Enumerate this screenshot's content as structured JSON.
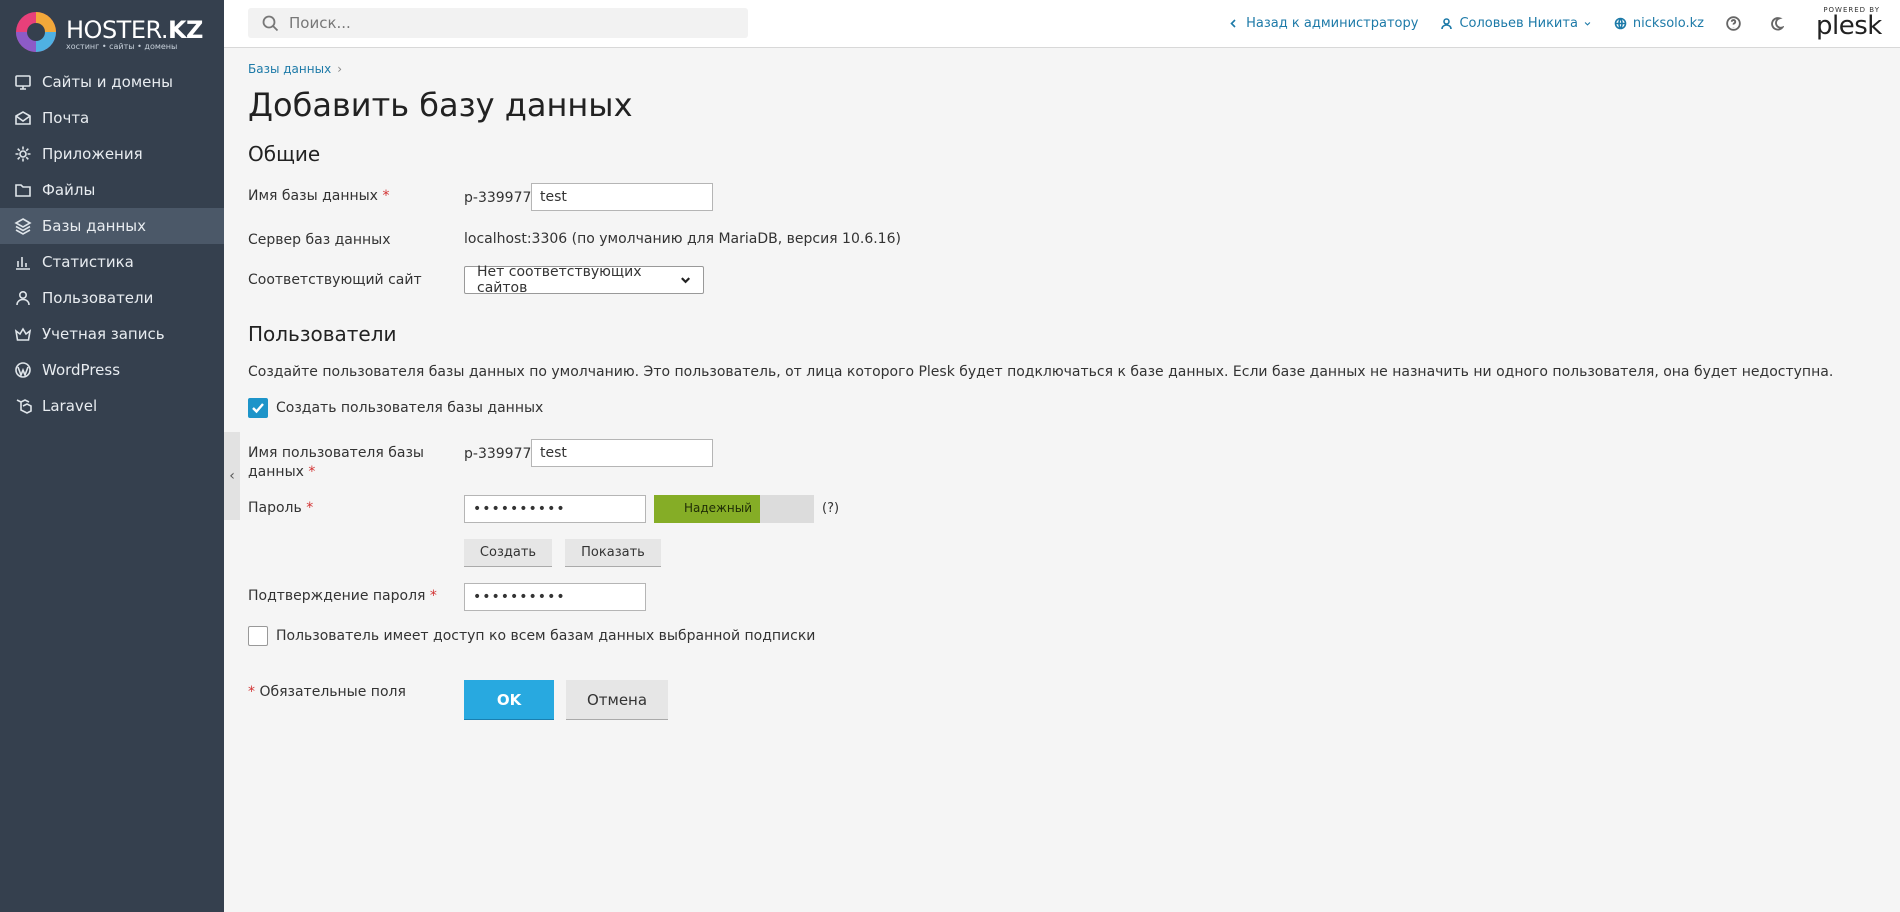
{
  "brand": {
    "logo_main": "HOSTER.",
    "logo_bold": "KZ",
    "logo_sub": "хостинг • сайты • домены",
    "plesk_powered": "POWERED BY",
    "plesk_name": "plesk"
  },
  "sidebar": {
    "items": [
      {
        "label": "Сайты и домены",
        "icon": "monitor-icon"
      },
      {
        "label": "Почта",
        "icon": "mail-icon"
      },
      {
        "label": "Приложения",
        "icon": "gear-icon"
      },
      {
        "label": "Файлы",
        "icon": "folder-icon"
      },
      {
        "label": "Базы данных",
        "icon": "layers-icon",
        "active": true
      },
      {
        "label": "Статистика",
        "icon": "bar-chart-icon"
      },
      {
        "label": "Пользователи",
        "icon": "user-icon"
      },
      {
        "label": "Учетная запись",
        "icon": "crown-icon"
      },
      {
        "label": "WordPress",
        "icon": "wordpress-icon"
      },
      {
        "label": "Laravel",
        "icon": "laravel-icon"
      }
    ]
  },
  "topbar": {
    "search_placeholder": "Поиск...",
    "back_link": "Назад к администратору",
    "user_name": "Соловьев Никита",
    "domain": "nicksolo.kz"
  },
  "breadcrumb": {
    "item": "Базы данных"
  },
  "page": {
    "title": "Добавить базу данных"
  },
  "general": {
    "title": "Общие",
    "db_name_label": "Имя базы данных",
    "db_name_prefix": "p-339977_",
    "db_name_value": "test",
    "db_server_label": "Сервер баз данных",
    "db_server_value": "localhost:3306 (по умолчанию для MariaDB, версия 10.6.16)",
    "site_label": "Соответствующий сайт",
    "site_value": "Нет соответствующих сайтов"
  },
  "users": {
    "title": "Пользователи",
    "description": "Создайте пользователя базы данных по умолчанию. Это пользователь, от лица которого Plesk будет подключаться к базе данных. Если базе данных не назначить ни одного пользователя, она будет недоступна.",
    "create_user_label": "Создать пользователя базы данных",
    "create_user_checked": true,
    "username_label_1": "Имя пользователя базы",
    "username_label_2": "данных",
    "username_prefix": "p-339977_",
    "username_value": "test",
    "password_label": "Пароль",
    "password_value": "••••••••••",
    "strength_label": "Надежный",
    "strength_fraction": 0.66,
    "help": "(?)",
    "generate_button": "Создать",
    "show_button": "Показать",
    "confirm_label": "Подтверждение пароля",
    "confirm_value": "••••••••••",
    "all_db_access_label": "Пользователь имеет доступ ко всем базам данных выбранной подписки",
    "all_db_access_checked": false
  },
  "footer": {
    "required_star": "*",
    "required_label": "Обязательные поля",
    "ok_button": "OK",
    "cancel_button": "Отмена"
  },
  "colors": {
    "sidebar_bg": "#35404e",
    "accent": "#28a9e0",
    "strength_good": "#85ad26",
    "required": "#d23232"
  }
}
